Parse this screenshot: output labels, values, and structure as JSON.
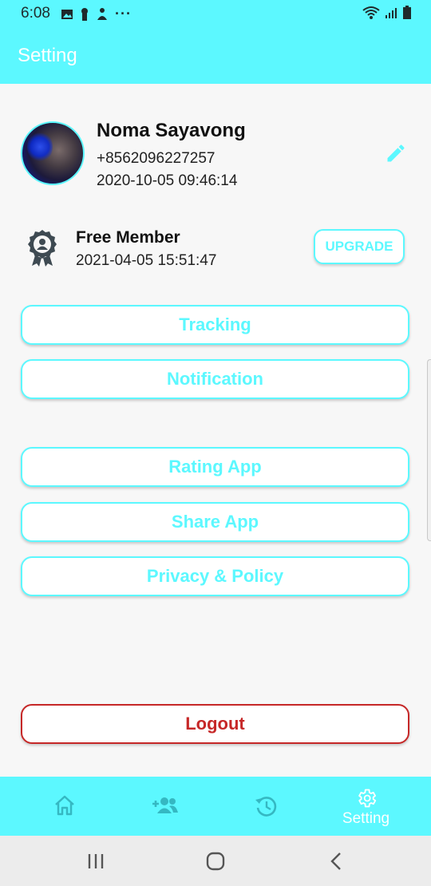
{
  "status_bar": {
    "time": "6:08",
    "icons_left": [
      "image-icon",
      "keyhole-icon",
      "notification-icon",
      "more-icon"
    ],
    "icons_right": [
      "wifi-icon",
      "signal-icon",
      "battery-icon"
    ],
    "more_label": "···"
  },
  "app_bar": {
    "title": "Setting"
  },
  "profile": {
    "name": "Noma Sayavong",
    "phone": "+8562096227257",
    "date": "2020-10-05 09:46:14",
    "edit_icon": "pencil-icon"
  },
  "membership": {
    "icon": "award-badge-icon",
    "title": "Free Member",
    "date": "2021-04-05 15:51:47",
    "upgrade_label": "UPGRADE"
  },
  "menu": {
    "tracking": "Tracking",
    "notification": "Notification",
    "rating": "Rating App",
    "share": "Share App",
    "privacy": "Privacy & Policy",
    "logout": "Logout"
  },
  "bottom_nav": {
    "items": [
      {
        "icon": "home-icon",
        "label": ""
      },
      {
        "icon": "add-friend-icon",
        "label": ""
      },
      {
        "icon": "history-icon",
        "label": ""
      },
      {
        "icon": "gear-icon",
        "label": "Setting",
        "active": true
      }
    ]
  },
  "system_nav": [
    "recent-apps-icon",
    "home-circle-icon",
    "back-icon"
  ],
  "colors": {
    "accent": "#5cf8ff",
    "logout": "#c62828",
    "background": "#f7f7f7",
    "nav_icon_inactive": "#35b8c2"
  }
}
